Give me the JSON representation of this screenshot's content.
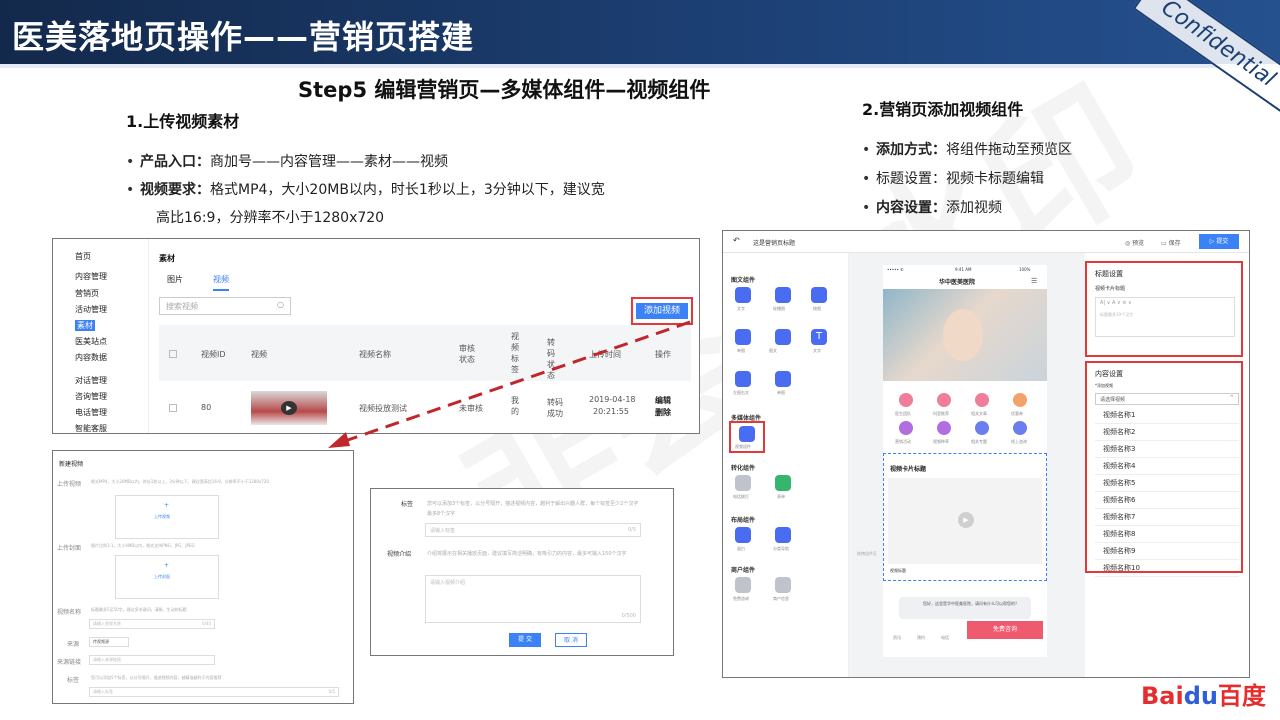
{
  "header": {
    "title": "医美落地页操作——营销页搭建",
    "badge": "Confidential"
  },
  "step_title": "Step5  编辑营销页—多媒体组件—视频组件",
  "section1": {
    "title": "1.上传视频素材",
    "bullets": [
      {
        "label": "产品入口：",
        "text": "商加号——内容管理——素材——视频"
      },
      {
        "label": "视频要求：",
        "text": "格式MP4，大小20MB以内，时长1秒以上，3分钟以下，建议宽"
      }
    ],
    "bullet2_cont": "高比16:9，分辨率不小于1280x720"
  },
  "section2": {
    "title": "2.营销页添加视频组件",
    "bullets": [
      {
        "label": "添加方式：",
        "text": "将组件拖动至预览区"
      },
      {
        "label": "",
        "text": "标题设置：视频卡标题编辑"
      },
      {
        "label": "内容设置：",
        "text": "添加视频"
      }
    ]
  },
  "material_panel": {
    "sidebar": [
      "首页",
      "内容管理",
      "营销页",
      "活动管理",
      "素材",
      "医美站点",
      "内容数据",
      "对话管理",
      "咨询管理",
      "电话管理",
      "智能客服"
    ],
    "title": "素材",
    "tabs": [
      "图片",
      "视频"
    ],
    "search_placeholder": "搜索视频",
    "add_button": "添加视频",
    "columns": [
      "视频ID",
      "视频",
      "视频名称",
      "审核状态",
      "视频标签",
      "转码状态",
      "上传时间",
      "操作"
    ],
    "row": {
      "id": "80",
      "name": "视频投放测试",
      "audit": "未审核",
      "tag": "我的",
      "transcode": "转码成功",
      "date": "2019-04-18",
      "time": "20:21:55",
      "edit": "编辑",
      "delete": "删除"
    }
  },
  "new_video_dialog": {
    "title": "新建视频",
    "upload_video": "上传视频",
    "upload_video_hint": "格式MP4，大小20MB以内，时长1秒以上，3分钟以下，建议宽高比16:9，分辨率不小于1280x720",
    "upload_btn": "上传视频",
    "upload_cover": "上传封面",
    "upload_cover_hint": "图片比例1:1，大小4MB以内，格式支持PNG、JPG、JPEG",
    "upload_cover_btn": "上传封面",
    "video_name": "视频名称",
    "video_name_hint": "标题最多5至50字，建议多关键词，清晰、生动的标题",
    "video_name_placeholder": "请输入视频名称",
    "video_name_count": "0/40",
    "source": "来源",
    "source_value": "传视频源",
    "source_link": "来源链接",
    "source_link_placeholder": "请输入来源链接",
    "tags": "标签",
    "tags_hint": "您可以添加5个标签，以分号隔开，描述视频内容，越精准越利于内容推荐",
    "tags_placeholder": "请输入标签",
    "tags_count": "0/5"
  },
  "tag_dialog": {
    "tag_label": "标签",
    "tag_hint": "您可以添加3个标签，以分号隔开，描述视频内容，越利于解出兴趣人群，每个标签至少2个汉字最多8个汉字",
    "tag_placeholder": "请输入标签",
    "tag_count": "0/5",
    "intro_label": "视频介绍",
    "intro_hint": "介绍将展示在相关播放页面，建议填写简洁明确，有吸引力的内容，最多可输入150个汉字",
    "intro_placeholder": "请输入视频介绍",
    "intro_count": "0/500",
    "submit": "提 交",
    "cancel": "取 消"
  },
  "editor": {
    "page_title": "这是营销页标题",
    "preview": "预览",
    "save": "保存",
    "submit": "提交",
    "groups": [
      {
        "name": "图文组件",
        "items": [
          "文字",
          "轮播图",
          "按图",
          "单图",
          "图文",
          "文字",
          "左图右文",
          "单图"
        ]
      },
      {
        "name": "多媒体组件",
        "items": [
          "视频组件"
        ]
      },
      {
        "name": "转化组件",
        "items": [
          "电话拨打",
          "表单"
        ]
      },
      {
        "name": "布局组件",
        "items": [
          "留白",
          "分类导航"
        ]
      },
      {
        "name": "商户组件",
        "items": [
          "免费咨询",
          "商户信息"
        ]
      }
    ],
    "phone": {
      "signal": "••••• ✆",
      "clock": "9:41 AM",
      "battery": "100%",
      "hospital": "华中医美医院",
      "nav": [
        "医生团队",
        "科室推荐",
        "相关文章",
        "优惠券",
        "营销活动",
        "视频种草",
        "相关专题",
        "线上咨询"
      ],
      "video_card_title": "视频卡片标题",
      "video_title": "视频标题",
      "chat_tip": "您好，这里是华中医美医院，请问有什么可以帮您的？",
      "bottom": [
        "资讯",
        "预约",
        "电话"
      ],
      "consult": "免费咨询",
      "drag_area": "拖拽组件区"
    },
    "settings": {
      "title_settings": "标题设置",
      "card_title_label": "视频卡片标题",
      "card_title_hint": "标题最多10个汉字",
      "content_settings": "内容设置",
      "add_video_label": "*添加视频",
      "select_placeholder": "请选择视频",
      "options": [
        "视频名称1",
        "视频名称2",
        "视频名称3",
        "视频名称4",
        "视频名称5",
        "视频名称6",
        "视频名称7",
        "视频名称8",
        "视频名称9",
        "视频名称10"
      ]
    }
  },
  "watermark": "非会员水印",
  "logo": {
    "left": "Bai",
    "paw": "du",
    "right": "百度"
  },
  "colors": {
    "header": "#1c3f73",
    "accent": "#3b82f6",
    "red": "#e23a3a",
    "baidu_red": "#e52d2d",
    "baidu_blue": "#2f5fd6"
  }
}
